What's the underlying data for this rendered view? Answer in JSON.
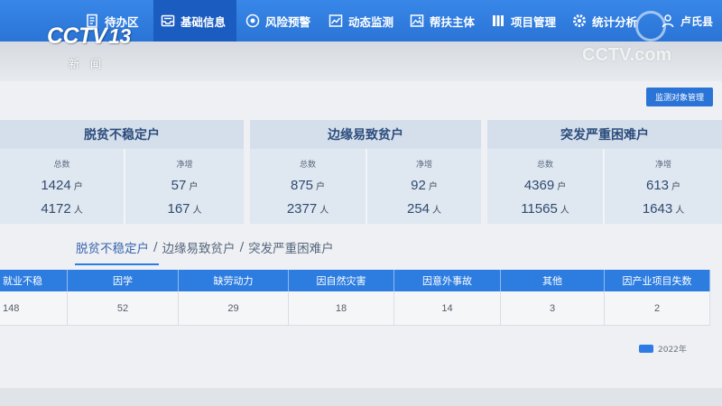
{
  "watermark": {
    "channel_logo": "CCTV",
    "channel_number": "13",
    "channel_name": "新闻",
    "site_logo": "CCTV.com"
  },
  "nav": {
    "items": [
      {
        "label": "待办区",
        "icon": "document-icon",
        "active": false
      },
      {
        "label": "基础信息",
        "icon": "inbox-icon",
        "active": true
      },
      {
        "label": "风险预警",
        "icon": "warning-icon",
        "active": false
      },
      {
        "label": "动态监测",
        "icon": "chart-icon",
        "active": false
      },
      {
        "label": "帮扶主体",
        "icon": "image-icon",
        "active": false
      },
      {
        "label": "项目管理",
        "icon": "bars-icon",
        "active": false
      },
      {
        "label": "统计分析",
        "icon": "gear-icon",
        "active": false
      }
    ],
    "user": {
      "label": "卢氏县",
      "icon": "user-icon"
    }
  },
  "toolbar": {
    "manage_button": "监测对象管理"
  },
  "summary": {
    "total_label": "总数",
    "net_label": "净增",
    "household_unit": "户",
    "person_unit": "人",
    "panels": [
      {
        "title": "脱贫不稳定户",
        "total_households": "1424",
        "total_persons": "4172",
        "net_households": "57",
        "net_persons": "167"
      },
      {
        "title": "边缘易致贫户",
        "total_households": "875",
        "total_persons": "2377",
        "net_households": "92",
        "net_persons": "254"
      },
      {
        "title": "突发严重困难户",
        "total_households": "4369",
        "total_persons": "11565",
        "net_households": "613",
        "net_persons": "1643"
      }
    ]
  },
  "tabs": {
    "items": [
      "脱贫不稳定户",
      "边缘易致贫户",
      "突发严重困难户"
    ],
    "separator": "/",
    "active_index": 0
  },
  "table": {
    "headers": [
      "就业不稳",
      "因学",
      "缺劳动力",
      "因自然灾害",
      "因意外事故",
      "其他",
      "因产业项目失数"
    ],
    "rows": [
      [
        "148",
        "52",
        "29",
        "18",
        "14",
        "3",
        "2"
      ]
    ]
  },
  "legend": {
    "label": "2022年",
    "color": "#2f7be6"
  },
  "colors": {
    "nav": "#2b78dc",
    "nav_active": "#1b5cc0",
    "table_header": "#2d7de0",
    "button": "#2a74d8"
  }
}
